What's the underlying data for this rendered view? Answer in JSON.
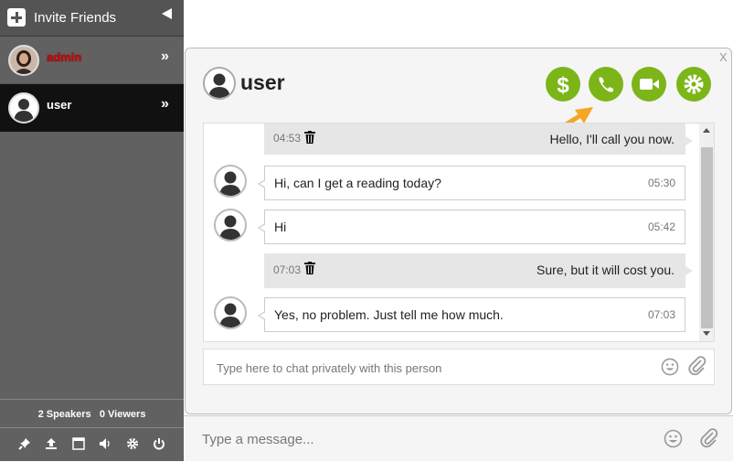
{
  "sidebar": {
    "invite_label": "Invite Friends",
    "users": [
      {
        "name": "admin",
        "name_color": "#dd0000"
      },
      {
        "name": "user",
        "name_color": "#ffffff"
      }
    ],
    "counts": {
      "speakers_num": "2",
      "speakers_label": "Speakers",
      "viewers_num": "0",
      "viewers_label": "Viewers"
    },
    "tool_icons": [
      "pin-icon",
      "upload-icon",
      "window-icon",
      "volume-icon",
      "gear-icon",
      "power-icon"
    ]
  },
  "private_chat": {
    "close_label": "X",
    "header_name": "user",
    "action_icons": [
      "dollar-icon",
      "phone-icon",
      "video-icon",
      "gear-icon"
    ],
    "accent_color": "#7cb518",
    "messages": [
      {
        "side": "mine",
        "time": "04:53",
        "text": "Hello, I'll call you now."
      },
      {
        "side": "theirs",
        "time": "05:30",
        "text": "Hi, can I get a reading today?"
      },
      {
        "side": "theirs",
        "time": "05:42",
        "text": "Hi"
      },
      {
        "side": "mine",
        "time": "07:03",
        "text": "Sure, but it will cost you."
      },
      {
        "side": "theirs",
        "time": "07:03",
        "text": "Yes, no problem. Just tell me how much."
      }
    ],
    "input_placeholder": "Type here to chat privately with this person"
  },
  "composer": {
    "placeholder": "Type a message..."
  }
}
